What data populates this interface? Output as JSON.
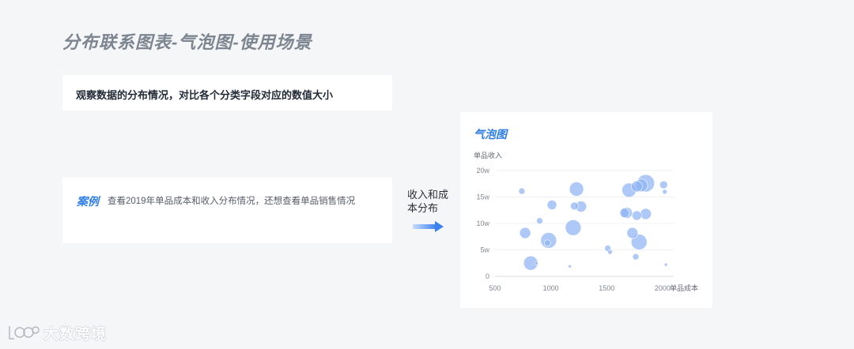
{
  "page": {
    "title": "分布联系图表-气泡图-使用场景"
  },
  "description": {
    "text": "观察数据的分布情况，对比各个分类字段对应的数值大小"
  },
  "case": {
    "tag": "案例",
    "text": "查看2019年单品成本和收入分布情况，还想查看单品销售情况"
  },
  "arrow": {
    "label": "收入和成本分布"
  },
  "watermark": {
    "text": "大数跨境",
    "icon": "logo-icon"
  },
  "colors": {
    "accent": "#2f7ee6",
    "bubble": "#8fb4f5",
    "title": "#7d8590"
  },
  "chart_data": {
    "type": "scatter",
    "title": "气泡图",
    "xlabel": "单品成本",
    "ylabel": "单品收入",
    "xlim": [
      500,
      2100
    ],
    "ylim": [
      0,
      200000
    ],
    "x_ticks": [
      "500",
      "1000",
      "1500",
      "2000"
    ],
    "x_tick_values": [
      500,
      1000,
      1500,
      2000
    ],
    "y_ticks": [
      "0",
      "5w",
      "10w",
      "15w",
      "20w"
    ],
    "y_tick_values": [
      0,
      50000,
      100000,
      150000,
      200000
    ],
    "grid": true,
    "series": [
      {
        "points": [
          {
            "x": 740,
            "y": 161000,
            "size": 4
          },
          {
            "x": 770,
            "y": 82000,
            "size": 7
          },
          {
            "x": 820,
            "y": 25000,
            "size": 9
          },
          {
            "x": 870,
            "y": 25000,
            "size": 2
          },
          {
            "x": 900,
            "y": 105000,
            "size": 4
          },
          {
            "x": 980,
            "y": 68000,
            "size": 10
          },
          {
            "x": 970,
            "y": 63000,
            "size": 4
          },
          {
            "x": 1010,
            "y": 135000,
            "size": 6
          },
          {
            "x": 1170,
            "y": 19000,
            "size": 2
          },
          {
            "x": 1200,
            "y": 92000,
            "size": 10
          },
          {
            "x": 1210,
            "y": 133000,
            "size": 5
          },
          {
            "x": 1230,
            "y": 165000,
            "size": 9
          },
          {
            "x": 1270,
            "y": 132000,
            "size": 7
          },
          {
            "x": 1510,
            "y": 53000,
            "size": 4
          },
          {
            "x": 1530,
            "y": 46000,
            "size": 3
          },
          {
            "x": 1660,
            "y": 120000,
            "size": 6
          },
          {
            "x": 1680,
            "y": 120000,
            "size": 7
          },
          {
            "x": 1700,
            "y": 163000,
            "size": 9
          },
          {
            "x": 1730,
            "y": 82000,
            "size": 7
          },
          {
            "x": 1760,
            "y": 37000,
            "size": 4
          },
          {
            "x": 1770,
            "y": 115000,
            "size": 6
          },
          {
            "x": 1770,
            "y": 170000,
            "size": 7
          },
          {
            "x": 1790,
            "y": 65000,
            "size": 10
          },
          {
            "x": 1810,
            "y": 172000,
            "size": 8
          },
          {
            "x": 1850,
            "y": 118000,
            "size": 7
          },
          {
            "x": 1850,
            "y": 176000,
            "size": 11
          },
          {
            "x": 2010,
            "y": 173000,
            "size": 5
          },
          {
            "x": 2020,
            "y": 160000,
            "size": 3
          },
          {
            "x": 2030,
            "y": 22000,
            "size": 2
          }
        ]
      }
    ]
  }
}
